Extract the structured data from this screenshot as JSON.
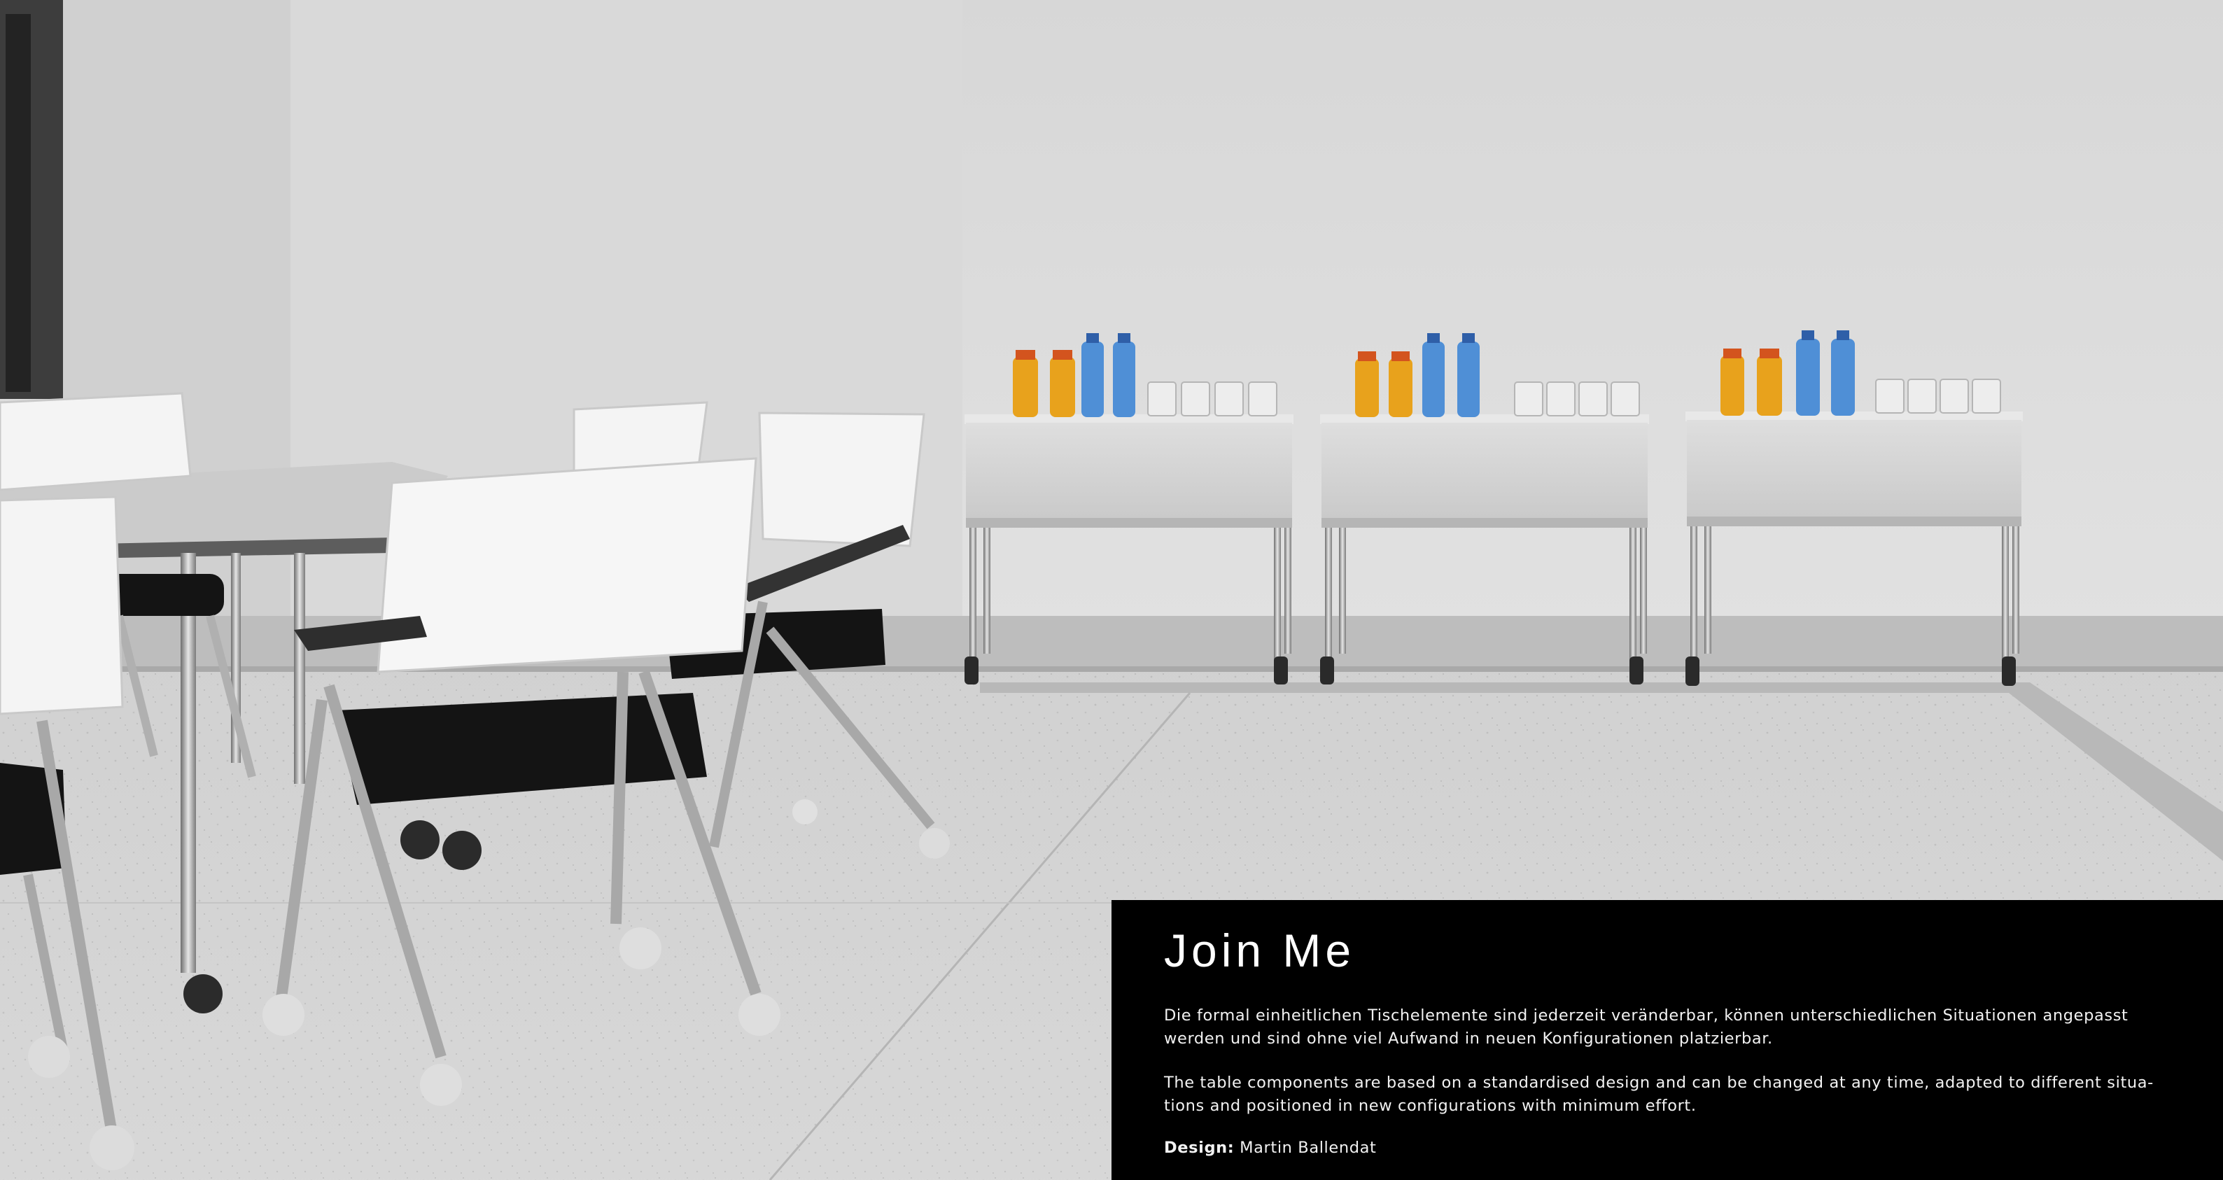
{
  "caption": {
    "title": "Join Me",
    "text_de": "Die formal einheitlichen Tischelemente sind jederzeit veränderbar, können unterschiedlichen Situationen angepasst werden und sind ohne viel Aufwand in neuen Konfigurationen platzierbar.",
    "text_en": "The table components are based on a standardised design and can be changed at any time, adapted to different situa-tions and positioned in new configurations with minimum effort.",
    "credit_label": "Design:",
    "credit_name": "Martin Ballendat"
  },
  "photo": {
    "subject": "meeting-room-with-folding-tables-and-chairs",
    "colors": {
      "wall": "#dcdcdc",
      "floor": "#d2d2d2",
      "chair_shell": "#f4f4f4",
      "chair_seat": "#141414",
      "chrome": "#9a9a9a",
      "juice": "#e8a21c",
      "water": "#4f8fd6"
    }
  }
}
